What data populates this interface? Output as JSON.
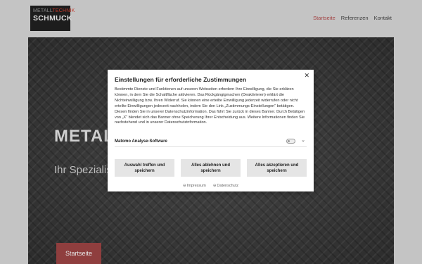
{
  "logo": {
    "line1a": "METALL",
    "line1b": "TECHNIK",
    "line2": "SCHMUCK"
  },
  "nav": {
    "items": [
      {
        "label": "Startseite",
        "active": true
      },
      {
        "label": "Referenzen",
        "active": false
      },
      {
        "label": "Kontakt",
        "active": false
      }
    ]
  },
  "hero": {
    "title": "METALL",
    "subtitle": "Ihr Spezialist",
    "button": "Startseite"
  },
  "modal": {
    "title": "Einstellungen für erforderliche Zustimmungen",
    "close": "✕",
    "body": "Bestimmte Dienste und Funktionen auf unseren Webseiten erfordern Ihre Einwilligung, die Sie erklären können, in dem Sie die Schaltfläche aktivieren. Das Rückgängigmachen (Deaktivieren) erklärt die Nichteinwilligung bzw. Ihren Widerruf. Sie können eine erteilte Einwilligung jederzeit widerrufen oder nicht erteilte Einwilligungen jederzeit nachholen, indem Sie den Link „Zustimmungs-Einstellungen“ betätigen. Diesen finden Sie in unserer Datenschutzinformation. Das führt Sie zurück in dieses Banner. Durch Betätigen von „X“ blendet sich das Banner ohne Speicherung Ihrer Entscheidung aus. Weitere Informationen finden Sie nachstehend und in unserer Datenschutzinformation.",
    "consent": {
      "label": "Matomo Analyse-Software",
      "enabled": false
    },
    "buttons": {
      "select": "Auswahl treffen und speichern",
      "reject": "Alles ablehnen und speichern",
      "accept": "Alles akzeptieren und speichern"
    },
    "links": {
      "impressum": "Impressum",
      "datenschutz": "Datenschutz"
    }
  },
  "colors": {
    "accent": "#a24141",
    "button_bg": "#8f3e3e",
    "overlay": "#c4c4c4"
  }
}
